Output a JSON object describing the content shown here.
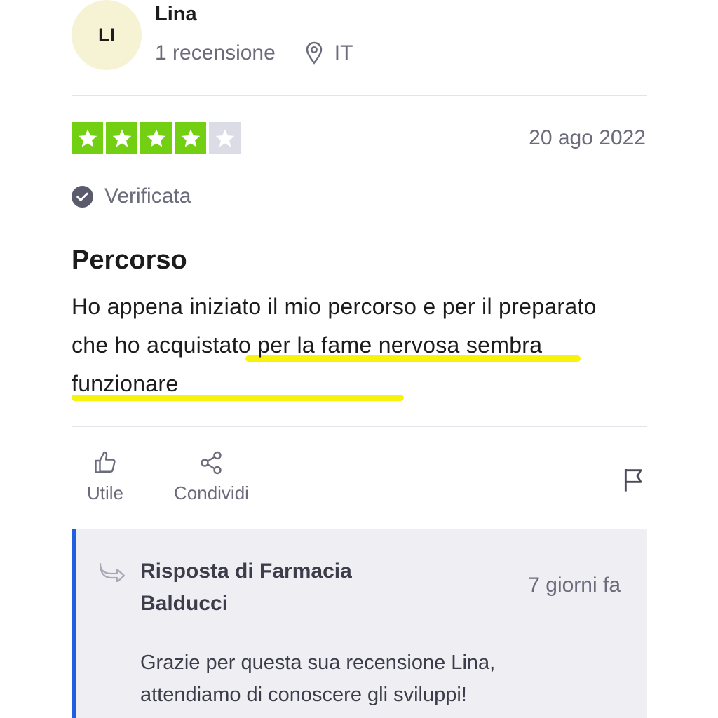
{
  "reviewer": {
    "initials": "LI",
    "name": "Lina",
    "review_count": "1 recensione",
    "country": "IT"
  },
  "review": {
    "rating": 4,
    "rating_max": 5,
    "date": "20 ago 2022",
    "verified_label": "Verificata",
    "title": "Percorso",
    "text_part1": "Ho appena iniziato il mio percorso e per il preparato che ",
    "text_highlight": "ho acquistato per la fame nervosa sembra funzionare"
  },
  "actions": {
    "useful_label": "Utile",
    "share_label": "Condividi"
  },
  "reply": {
    "title": "Risposta di Farmacia Balducci",
    "time": "7 giorni fa",
    "text": "Grazie per questa sua recensione Lina, attendiamo di conoscere gli sviluppi!"
  },
  "colors": {
    "star_filled": "#73cf11",
    "star_empty": "#dcdce6",
    "highlight": "#f7f200",
    "reply_accent": "#1f5fe0"
  },
  "icons": [
    "location-pin-icon",
    "verified-check-icon",
    "star-icon",
    "thumbs-up-icon",
    "share-icon",
    "flag-icon",
    "reply-arrow-icon"
  ]
}
